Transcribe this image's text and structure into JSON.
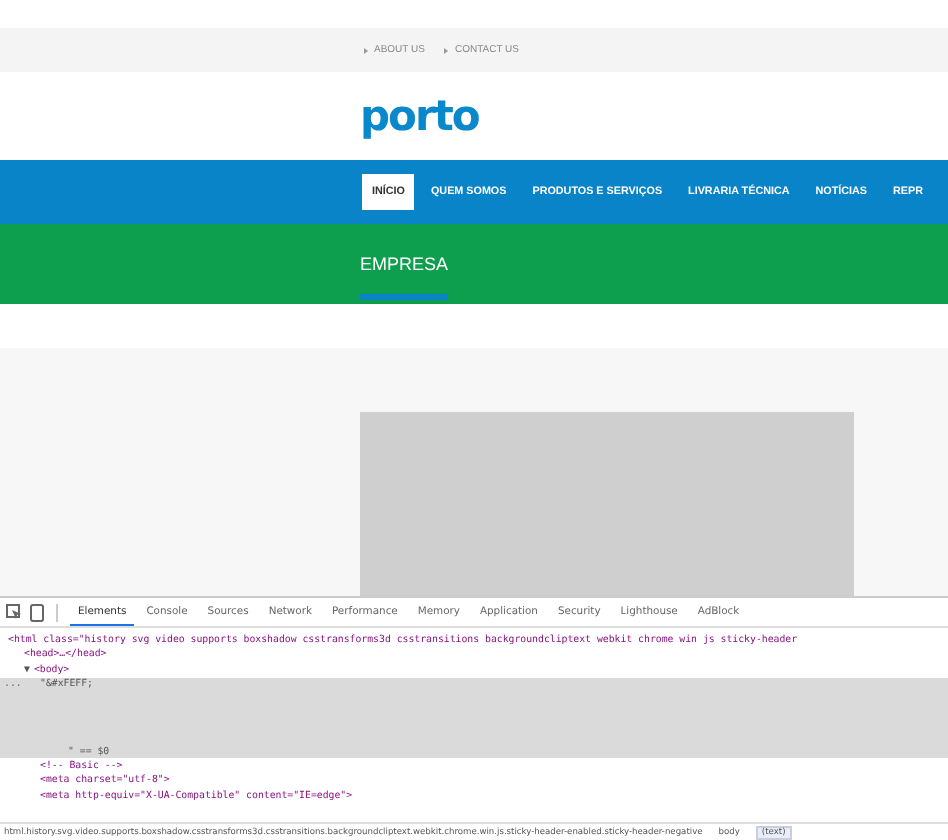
{
  "top_links": [
    "ABOUT US",
    "CONTACT US"
  ],
  "logo": "porto",
  "nav": [
    {
      "label": "INÍCIO",
      "selected": true
    },
    {
      "label": "QUEM SOMOS",
      "selected": false
    },
    {
      "label": "PRODUTOS E SERVIÇOS",
      "selected": false
    },
    {
      "label": "LIVRARIA TÉCNICA",
      "selected": false
    },
    {
      "label": "NOTÍCIAS",
      "selected": false
    },
    {
      "label": "REPR",
      "selected": false
    }
  ],
  "page_title": "EMPRESA",
  "content": {
    "kind": "placeholder-image"
  },
  "devtools": {
    "tabs": [
      {
        "label": "Elements",
        "selected": true
      },
      {
        "label": "Console",
        "selected": false
      },
      {
        "label": "Sources",
        "selected": false
      },
      {
        "label": "Network",
        "selected": false
      },
      {
        "label": "Performance",
        "selected": false
      },
      {
        "label": "Memory",
        "selected": false
      },
      {
        "label": "Application",
        "selected": false
      },
      {
        "label": "Security",
        "selected": false
      },
      {
        "label": "Lighthouse",
        "selected": false
      },
      {
        "label": "AdBlock",
        "selected": false
      }
    ],
    "dom_tree": [
      {
        "kind": "element",
        "text": "<html class=\"history svg video supports boxshadow csstransforms3d csstransitions backgroundcliptext webkit chrome win js sticky-header",
        "selected": false,
        "children": [
          {
            "kind": "element",
            "text": "<head>…</head>",
            "selected": false
          },
          {
            "kind": "element",
            "toggle": "▼",
            "text": "<body>",
            "selected": false,
            "children": [
              {
                "kind": "textnode",
                "gutter": "...",
                "text": "\"&#xFEFF;",
                "text_end": "\" == $0",
                "selected": true
              },
              {
                "kind": "element",
                "text": "<!-- Basic -->",
                "selected": false
              },
              {
                "kind": "element",
                "text": "<meta charset=\"utf-8\">",
                "selected": false
              },
              {
                "kind": "element",
                "text": "<meta http-equiv=\"X-UA-Compatible\" content=\"IE=edge\">",
                "selected": false
              }
            ]
          }
        ]
      }
    ],
    "breadcrumbs": [
      {
        "label": "html.history.svg.video.supports.boxshadow.csstransforms3d.csstransitions.backgroundcliptext.webkit.chrome.win.js.sticky-header-enabled.sticky-header-negative",
        "selected": false
      },
      {
        "label": "body",
        "selected": false
      },
      {
        "label": "(text)",
        "selected": true
      }
    ]
  }
}
